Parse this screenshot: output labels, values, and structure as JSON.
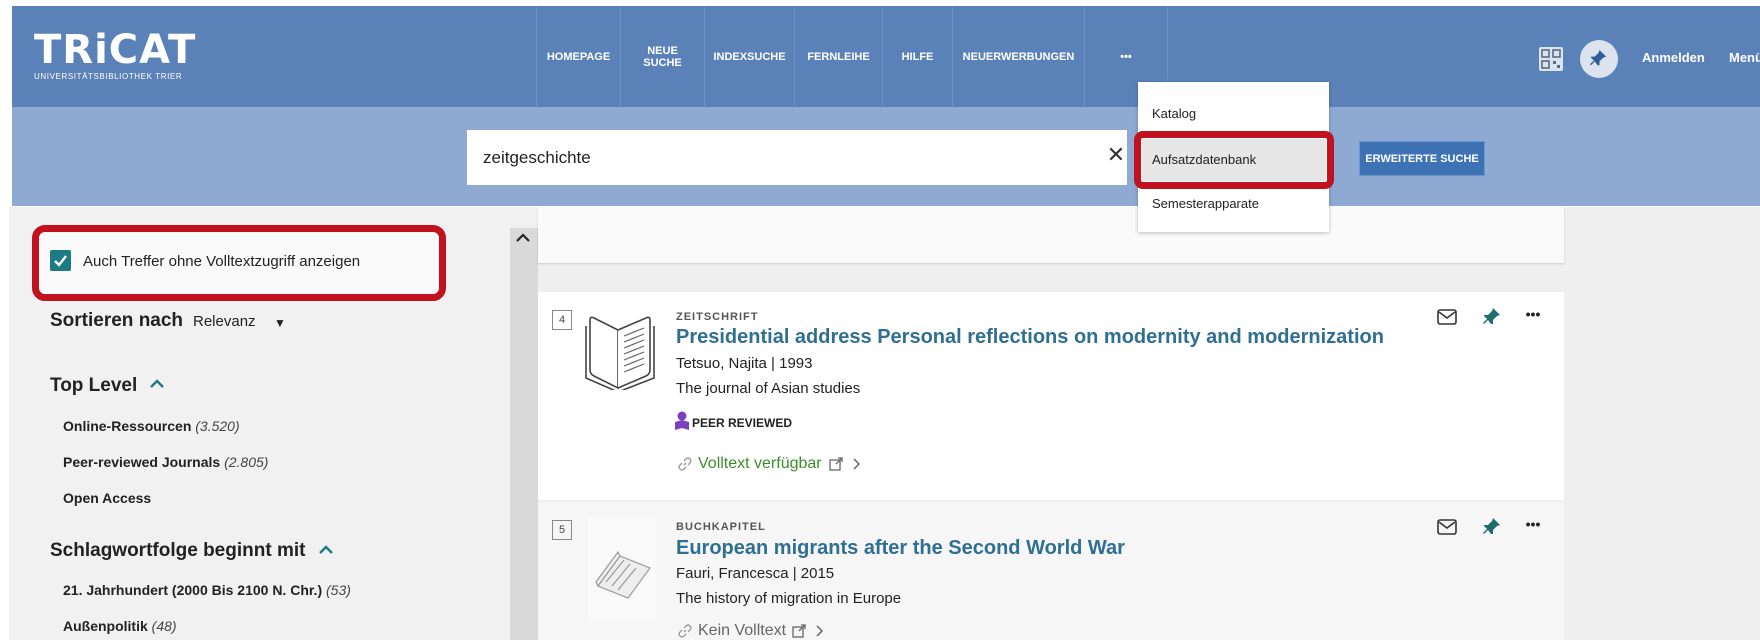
{
  "header": {
    "logo_main": "TRiCAT",
    "logo_sub": "UNIVERSITÄTSBIBLIOTHEK TRIER",
    "nav": [
      {
        "label": "HOMEPAGE"
      },
      {
        "label": "NEUE SUCHE"
      },
      {
        "label": "INDEXSUCHE"
      },
      {
        "label": "FERNLEIHE"
      },
      {
        "label": "HILFE"
      },
      {
        "label": "NEUERWERBUNGEN"
      },
      {
        "label": "•••"
      }
    ],
    "login": "Anmelden",
    "menu": "Menü"
  },
  "search": {
    "value": "zeitgeschichte",
    "advanced": "ERWEITERTE SUCHE"
  },
  "dropdown": {
    "items": [
      "Katalog",
      "Aufsatzdatenbank",
      "Semesterapparate"
    ]
  },
  "sidebar": {
    "checkbox_label": "Auch Treffer ohne Volltextzugriff anzeigen",
    "sort_label": "Sortieren nach",
    "sort_value": "Relevanz",
    "top_level": {
      "title": "Top Level",
      "items": [
        {
          "label": "Online-Ressourcen",
          "count": "(3.520)"
        },
        {
          "label": "Peer-reviewed Journals",
          "count": "(2.805)"
        },
        {
          "label": "Open Access",
          "count": ""
        }
      ]
    },
    "subject": {
      "title": "Schlagwortfolge beginnt mit",
      "items": [
        {
          "label": "21. Jahrhundert (2000 Bis 2100 N. Chr.)",
          "count": "(53)"
        },
        {
          "label": "Außenpolitik",
          "count": "(48)"
        }
      ]
    }
  },
  "results": [
    {
      "num": "4",
      "type": "ZEITSCHRIFT",
      "title": "Presidential address Personal reflections on modernity and modernization",
      "author_year": "Tetsuo, Najita | 1993",
      "source": "The journal of Asian studies",
      "peer": "PEER REVIEWED",
      "access": "Volltext verfügbar"
    },
    {
      "num": "5",
      "type": "BUCHKAPITEL",
      "title": "European migrants after the Second World War",
      "author_year": "Fauri, Francesca | 2015",
      "source": "The history of migration in Europe",
      "access": "Kein Volltext"
    }
  ]
}
